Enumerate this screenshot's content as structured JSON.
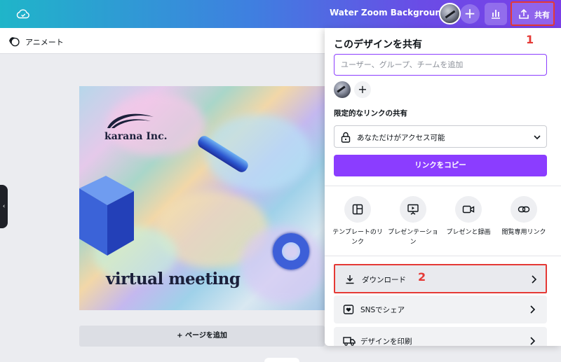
{
  "topbar": {
    "title": "Water Zoom Background",
    "add_symbol": "+",
    "share_label": "共有"
  },
  "toolbar": {
    "animate_label": "アニメート"
  },
  "side_tab": {
    "symbol": "‹"
  },
  "canvas": {
    "company": "karana Inc.",
    "headline": "virtual meeting"
  },
  "add_page_label": "+ ページを追加",
  "share_panel": {
    "title": "このデザインを共有",
    "annotation_1": "1",
    "people_input": {
      "value": "",
      "placeholder": "ユーザー、グループ、チームを追加"
    },
    "add_person_symbol": "+",
    "limited_link_label": "限定的なリンクの共有",
    "access_value": "あなただけがアクセス可能",
    "copy_link_label": "リンクをコピー",
    "options": [
      {
        "label": "テンプレートのリンク",
        "icon": "template-icon"
      },
      {
        "label": "プレゼンテーション",
        "icon": "presentation-icon"
      },
      {
        "label": "プレゼンと録画",
        "icon": "video-camera-icon"
      },
      {
        "label": "閲覧専用リンク",
        "icon": "link-icon"
      }
    ],
    "rows": {
      "download": "ダウンロード",
      "sns": "SNSでシェア",
      "print": "デザインを印刷"
    },
    "annotation_2": "2"
  },
  "colors": {
    "accent": "#8b3dff",
    "annotation": "#e53935",
    "topbar_start": "#1fb5c9",
    "topbar_end": "#7b3fe8"
  }
}
